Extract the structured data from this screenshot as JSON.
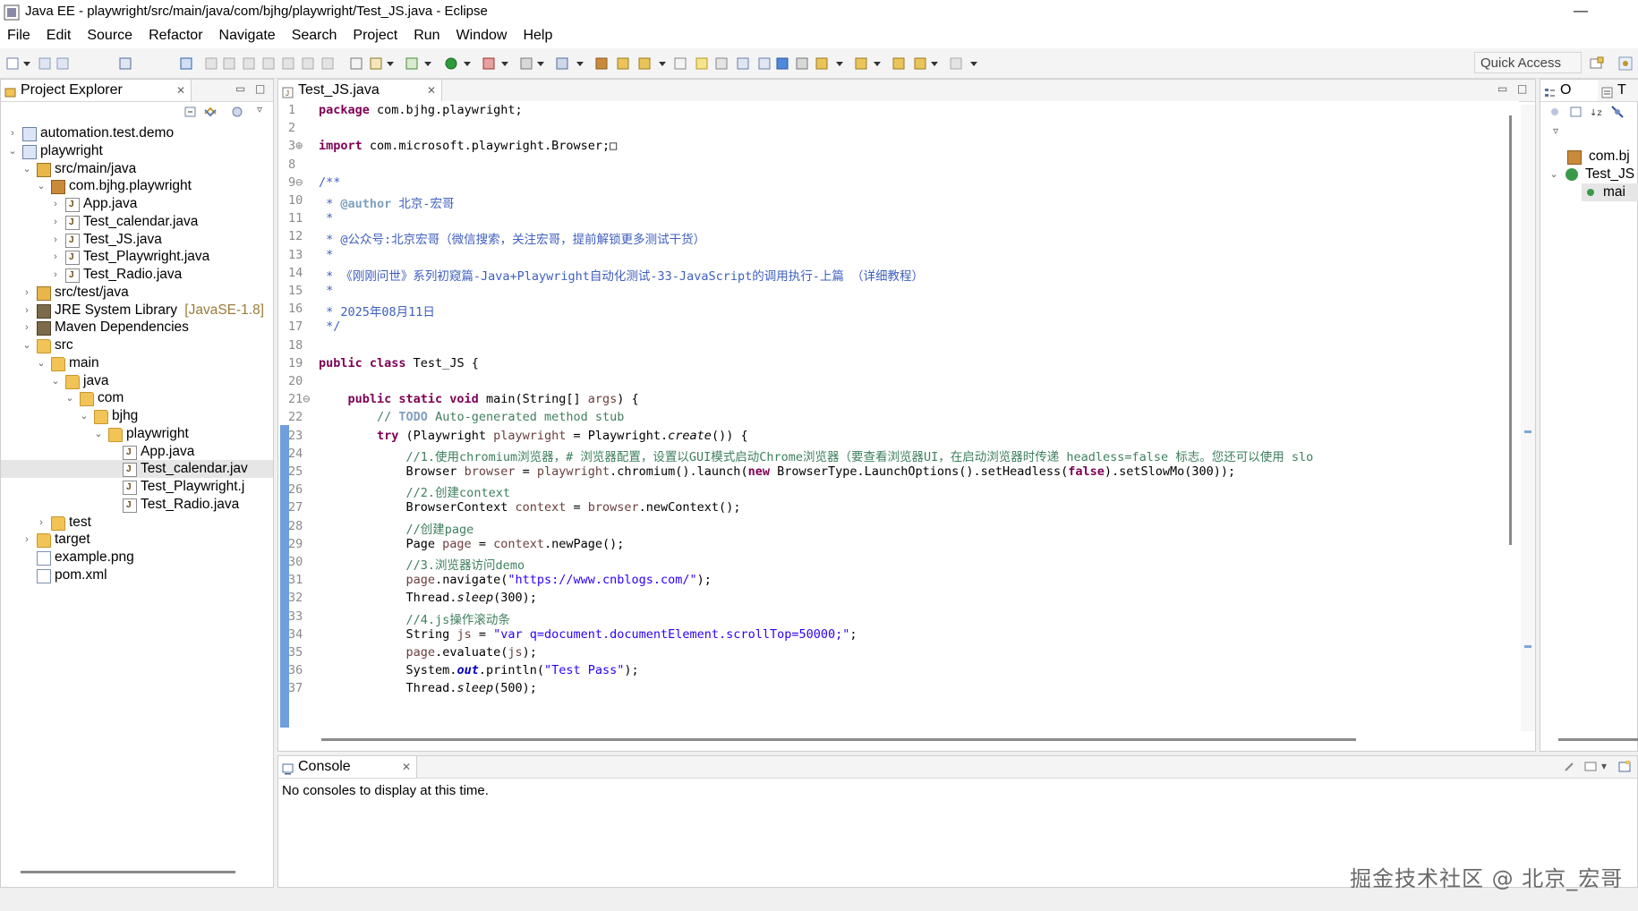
{
  "window": {
    "title": "Java EE - playwright/src/main/java/com/bjhg/playwright/Test_JS.java - Eclipse",
    "minimize": "—"
  },
  "menu": [
    "File",
    "Edit",
    "Source",
    "Refactor",
    "Navigate",
    "Search",
    "Project",
    "Run",
    "Window",
    "Help"
  ],
  "toolbar": {
    "quick_access": "Quick Access"
  },
  "project_explorer": {
    "tab_label": "Project Explorer",
    "close": "✕",
    "items": [
      {
        "label": "automation.test.demo",
        "twisty": "›"
      },
      {
        "label": "playwright",
        "twisty": "⌄"
      },
      {
        "label": "src/main/java",
        "twisty": "⌄"
      },
      {
        "label": "com.bjhg.playwright",
        "twisty": "⌄"
      },
      {
        "label": "App.java",
        "twisty": "›"
      },
      {
        "label": "Test_calendar.java",
        "twisty": "›"
      },
      {
        "label": "Test_JS.java",
        "twisty": "›"
      },
      {
        "label": "Test_Playwright.java",
        "twisty": "›"
      },
      {
        "label": "Test_Radio.java",
        "twisty": "›"
      },
      {
        "label": "src/test/java",
        "twisty": "›"
      },
      {
        "label": "JRE System Library",
        "suffix": "[JavaSE-1.8]",
        "twisty": "›"
      },
      {
        "label": "Maven Dependencies",
        "twisty": "›"
      },
      {
        "label": "src",
        "twisty": "⌄"
      },
      {
        "label": "main",
        "twisty": "⌄"
      },
      {
        "label": "java",
        "twisty": "⌄"
      },
      {
        "label": "com",
        "twisty": "⌄"
      },
      {
        "label": "bjhg",
        "twisty": "⌄"
      },
      {
        "label": "playwright",
        "twisty": "⌄"
      },
      {
        "label": "App.java",
        "twisty": ""
      },
      {
        "label": "Test_calendar.jav",
        "twisty": ""
      },
      {
        "label": "Test_Playwright.j",
        "twisty": ""
      },
      {
        "label": "Test_Radio.java",
        "twisty": ""
      },
      {
        "label": "test",
        "twisty": "›"
      },
      {
        "label": "target",
        "twisty": "›"
      },
      {
        "label": "example.png",
        "twisty": ""
      },
      {
        "label": "pom.xml",
        "twisty": ""
      }
    ]
  },
  "editor": {
    "tab_label": "Test_JS.java",
    "close": "✕",
    "lines": [
      {
        "n": "1",
        "html": "<span class='kw'>package</span> com.bjhg.playwright;"
      },
      {
        "n": "2",
        "html": ""
      },
      {
        "n": "3⊕",
        "html": "<span class='kw'>import</span> com.microsoft.playwright.Browser;&#9633;"
      },
      {
        "n": "8",
        "html": ""
      },
      {
        "n": "9⊖",
        "html": "<span class='jd'>/**</span>"
      },
      {
        "n": "10",
        "html": "<span class='jd'> * <span class='tag'>@author</span> 北京-宏哥</span>"
      },
      {
        "n": "11",
        "html": "<span class='jd'> *</span>"
      },
      {
        "n": "12",
        "html": "<span class='jd'> * @公众号:北京宏哥（微信搜索，关注宏哥，提前解锁更多测试干货）</span>"
      },
      {
        "n": "13",
        "html": "<span class='jd'> *</span>"
      },
      {
        "n": "14",
        "html": "<span class='jd'> * 《刚刚问世》系列初窥篇-Java+Playwright自动化测试-33-JavaScript的调用执行-上篇 （详细教程）</span>"
      },
      {
        "n": "15",
        "html": "<span class='jd'> *</span>"
      },
      {
        "n": "16",
        "html": "<span class='jd'> * 2025年08月11日</span>"
      },
      {
        "n": "17",
        "html": "<span class='jd'> */</span>"
      },
      {
        "n": "18",
        "html": ""
      },
      {
        "n": "19",
        "html": "<span class='kw'>public class</span> Test_JS {"
      },
      {
        "n": "20",
        "html": ""
      },
      {
        "n": "21⊖",
        "html": "    <span class='kw'>public static void</span> main(String[] <span class='fld'>args</span>) {"
      },
      {
        "n": "22",
        "html": "        <span class='cm'>// <span class='todo'>TODO</span> Auto-generated method stub</span>"
      },
      {
        "n": "23",
        "html": "        <span class='kw'>try</span> (Playwright <span class='fld'>playwright</span> = Playwright.<span class='it'>create</span>()) {"
      },
      {
        "n": "24",
        "html": "            <span class='cm'>//1.使用chromium浏览器，# 浏览器配置，设置以GUI模式启动Chrome浏览器（要查看浏览器UI，在启动浏览器时传递 headless=false 标志。您还可以使用 slo</span>"
      },
      {
        "n": "25",
        "html": "            Browser <span class='fld'>browser</span> = <span class='fld'>playwright</span>.chromium().launch(<span class='kw'>new</span> BrowserType.LaunchOptions().setHeadless(<span class='kw'>false</span>).setSlowMo(300));"
      },
      {
        "n": "26",
        "html": "            <span class='cm'>//2.创建context</span>"
      },
      {
        "n": "27",
        "html": "            BrowserContext <span class='fld'>context</span> = <span class='fld'>browser</span>.newContext();"
      },
      {
        "n": "28",
        "html": "            <span class='cm'>//创建page</span>"
      },
      {
        "n": "29",
        "html": "            Page <span class='fld'>page</span> = <span class='fld'>context</span>.newPage();"
      },
      {
        "n": "30",
        "html": "            <span class='cm'>//3.浏览器访问demo</span>"
      },
      {
        "n": "31",
        "html": "            <span class='fld'>page</span>.navigate(<span class='str'>\"https://www.cnblogs.com/\"</span>);"
      },
      {
        "n": "32",
        "html": "            Thread.<span class='it'>sleep</span>(300);"
      },
      {
        "n": "33",
        "html": "            <span class='cm'>//4.js操作滚动条</span>"
      },
      {
        "n": "34",
        "html": "            String <span class='fld'>js</span> = <span class='str'>\"var q=document.documentElement.scrollTop=50000;\"</span>;"
      },
      {
        "n": "35",
        "html": "            <span class='fld'>page</span>.evaluate(<span class='fld'>js</span>);"
      },
      {
        "n": "36",
        "html": "            System.<span class='sf'>out</span>.println(<span class='str'>\"Test Pass\"</span>);"
      },
      {
        "n": "37",
        "html": "            Thread.<span class='it'>sleep</span>(500);"
      }
    ]
  },
  "outline": {
    "tab1": "O",
    "tab2": "T",
    "items": [
      "com.bj",
      "Test_JS",
      "mai"
    ]
  },
  "console": {
    "tab_label": "Console",
    "close": "✕",
    "message": "No consoles to display at this time."
  },
  "watermark": "掘金技术社区 @ 北京_宏哥",
  "colors": {
    "keyword": "#7f0055",
    "comment": "#3f7f5f",
    "javadoc": "#3f5fbf",
    "string": "#2a00ff",
    "field": "#6a3e3e"
  }
}
